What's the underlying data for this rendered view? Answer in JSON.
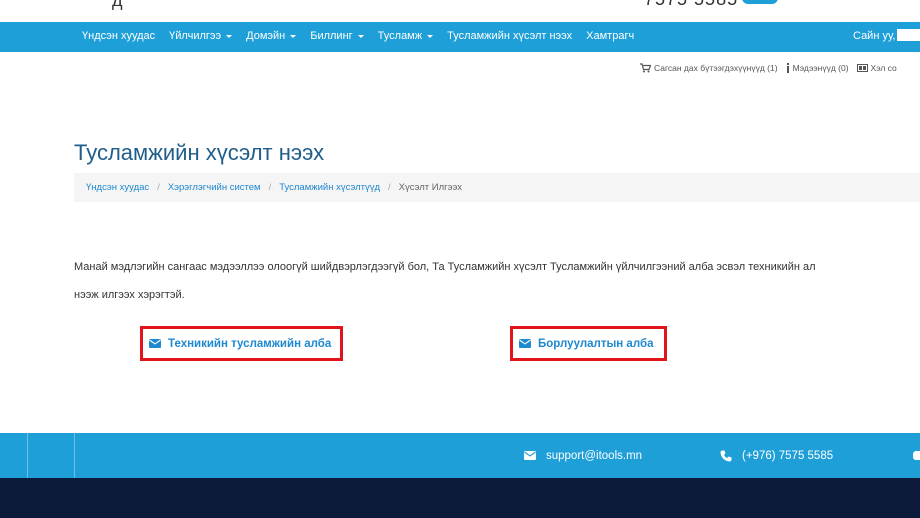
{
  "nav": {
    "items": [
      {
        "label": "Үндсэн хуудас",
        "dropdown": false
      },
      {
        "label": "Үйлчилгээ",
        "dropdown": true
      },
      {
        "label": "Домэйн",
        "dropdown": true
      },
      {
        "label": "Биллинг",
        "dropdown": true
      },
      {
        "label": "Тусламж",
        "dropdown": true
      },
      {
        "label": "Тусламжийн хүсэлт нээх",
        "dropdown": false
      },
      {
        "label": "Хамтрагч",
        "dropdown": false
      }
    ],
    "greeting": "Сайн уу,"
  },
  "utility": {
    "cart": "Сагсан дах бүтээгдэхүүнүүд (1)",
    "notifications": "Мэдээнүүд (0)",
    "language": "Хэл со"
  },
  "page": {
    "title": "Тусламжийн хүсэлт нээх"
  },
  "breadcrumb": {
    "items": [
      "Үндсэн хуудас",
      "Хэрэглэгчийн систем",
      "Тусламжийн хүсэлтүүд"
    ],
    "current": "Хүсэлт Илгээх"
  },
  "intro": {
    "line1": "Манай мэдлэгийн сангаас мэдээллээ олоогүй шийдвэрлэгдээгүй бол, Та Тусламжийн хүсэлт Тусламжийн үйлчилгээний алба эсвэл техникийн ал",
    "line2": "нээж илгээх хэрэгтэй."
  },
  "departments": {
    "tech": "Техникийн тусламжийн алба",
    "sales": "Борлуулалтын алба"
  },
  "footer": {
    "email": "support@itools.mn",
    "phone": "(+976) 7575 5585"
  },
  "colors": {
    "primary": "#1e9fd8",
    "link": "#1e88d0",
    "title": "#1f5e8c",
    "highlight": "#e1141c",
    "footer_dark": "#0c1a3a"
  },
  "icons": {
    "cart": "cart-icon",
    "notifications": "info-icon",
    "language": "language-icon",
    "department": "envelope-icon",
    "email": "envelope-icon",
    "phone": "phone-icon"
  }
}
